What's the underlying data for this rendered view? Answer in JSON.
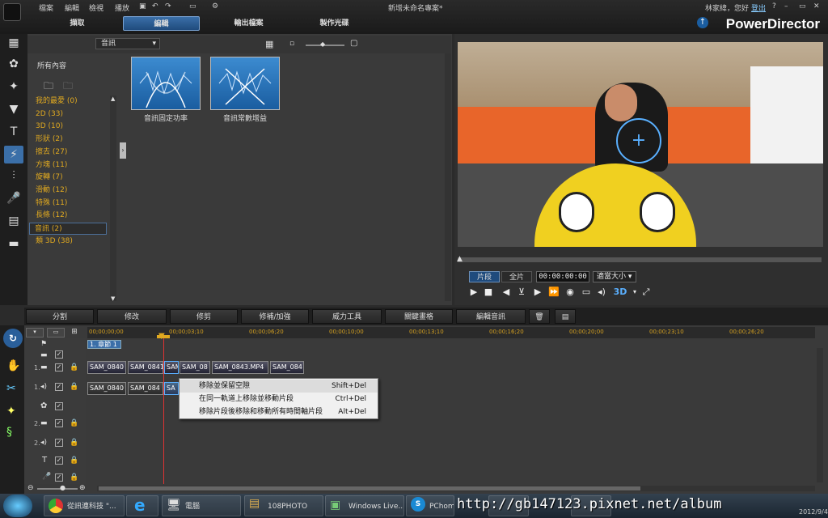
{
  "menu": [
    "檔案",
    "編輯",
    "檢視",
    "播放"
  ],
  "window_title": "新增未命名專案*",
  "user": {
    "greeting": "林家緯，您好",
    "logout": "登出"
  },
  "tabs": [
    {
      "label": "擷取"
    },
    {
      "label": "編輯",
      "active": true
    },
    {
      "label": "輸出檔案"
    },
    {
      "label": "製作光碟"
    }
  ],
  "brand": "PowerDirector",
  "library": {
    "dropdown": "音訊",
    "all_content": "所有內容",
    "categories": [
      {
        "label": "我的最愛 (0)"
      },
      {
        "label": "2D (33)"
      },
      {
        "label": "3D (10)"
      },
      {
        "label": "形狀 (2)"
      },
      {
        "label": "擦去 (27)"
      },
      {
        "label": "方塊 (11)"
      },
      {
        "label": "旋轉 (7)"
      },
      {
        "label": "滑動 (12)"
      },
      {
        "label": "特殊 (11)"
      },
      {
        "label": "長條 (12)"
      },
      {
        "label": "音訊 (2)",
        "selected": true
      },
      {
        "label": "類 3D (38)"
      }
    ],
    "items": [
      {
        "label": "音訊固定功率"
      },
      {
        "label": "音訊常數增益"
      }
    ]
  },
  "preview": {
    "mode_clip": "片段",
    "mode_full": "全片",
    "timecode": "00:00:00:00",
    "zoom": "適當大小",
    "threed": "3D"
  },
  "toolbar": [
    "分割",
    "修改",
    "修剪",
    "修補/加強",
    "威力工具",
    "關鍵畫格",
    "編輯音訊"
  ],
  "timeline": {
    "ruler": [
      "00;00;00;00",
      "00;00;03;10",
      "00;00;06;20",
      "00;00;10;00",
      "00;00;13;10",
      "00;00;16;20",
      "00;00;20;00",
      "00;00;23;10",
      "00;00;26;20"
    ],
    "chapter": "1. 章節 1",
    "track_labels": [
      "1.",
      "1.",
      "2.",
      "2."
    ],
    "video_clips": [
      "SAM_0840",
      "SAM_0841",
      "SAM",
      "SAM_08",
      "SAM_0843.MP4",
      "SAM_084"
    ],
    "audio_clips": [
      "SAM_0840",
      "SAM_084",
      "SA"
    ]
  },
  "context_menu": [
    {
      "label": "移除並保留空隙",
      "shortcut": "Shift+Del",
      "highlighted": true
    },
    {
      "label": "在同一軌道上移除並移動片段",
      "shortcut": "Ctrl+Del"
    },
    {
      "label": "移除片段後移除和移動所有時間軸片段",
      "shortcut": "Alt+Del"
    }
  ],
  "taskbar": [
    "從訊連科技 \"...",
    "",
    "電腦",
    "108PHOTO",
    "Windows Live...",
    "PChome",
    "",
    ""
  ],
  "watermark": "http://gb147123.pixnet.net/album",
  "date_hint": "2012/9/4"
}
